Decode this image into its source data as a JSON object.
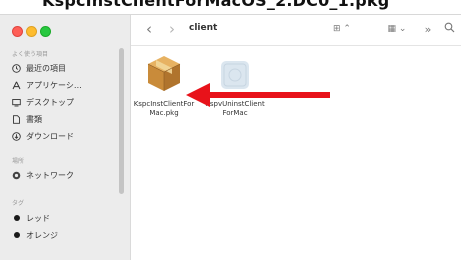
{
  "top_strip": {
    "text": "KspcInstClientForMacOS_2.DC0_1.pkg"
  },
  "window": {
    "path_title": "client",
    "toolbar": {
      "back_glyph": "‹",
      "forward_glyph": "›",
      "view_glyph": "⊞ ⌃",
      "group_glyph": "▦ ⌄",
      "more_glyph": "»",
      "search_glyph": "⌕"
    }
  },
  "sidebar": {
    "favorites_label": "よく使う項目",
    "favorites": [
      {
        "label": "最近の項目",
        "icon": "clock-icon"
      },
      {
        "label": "アプリケーシ…",
        "icon": "apps-icon"
      },
      {
        "label": "デスクトップ",
        "icon": "desktop-icon"
      },
      {
        "label": "書類",
        "icon": "document-icon"
      },
      {
        "label": "ダウンロード",
        "icon": "download-icon"
      }
    ],
    "locations_label": "場所",
    "locations": [
      {
        "label": "ネットワーク",
        "icon": "network-icon"
      }
    ],
    "tags_label": "タグ",
    "tags": [
      {
        "label": "レッド",
        "color": "#1a1a1a"
      },
      {
        "label": "オレンジ",
        "color": "#1a1a1a"
      }
    ]
  },
  "files": [
    {
      "name_line1": "KspcInstClientFor",
      "name_line2": "Mac.pkg",
      "icon": "package-icon"
    },
    {
      "name_line1": "KspvUninstClient",
      "name_line2": "ForMac",
      "icon": "app-placeholder-icon"
    }
  ],
  "colors": {
    "arrow": "#e8121a",
    "sidebar_bg": "#ececec",
    "package_brown": "#c98b3a"
  }
}
